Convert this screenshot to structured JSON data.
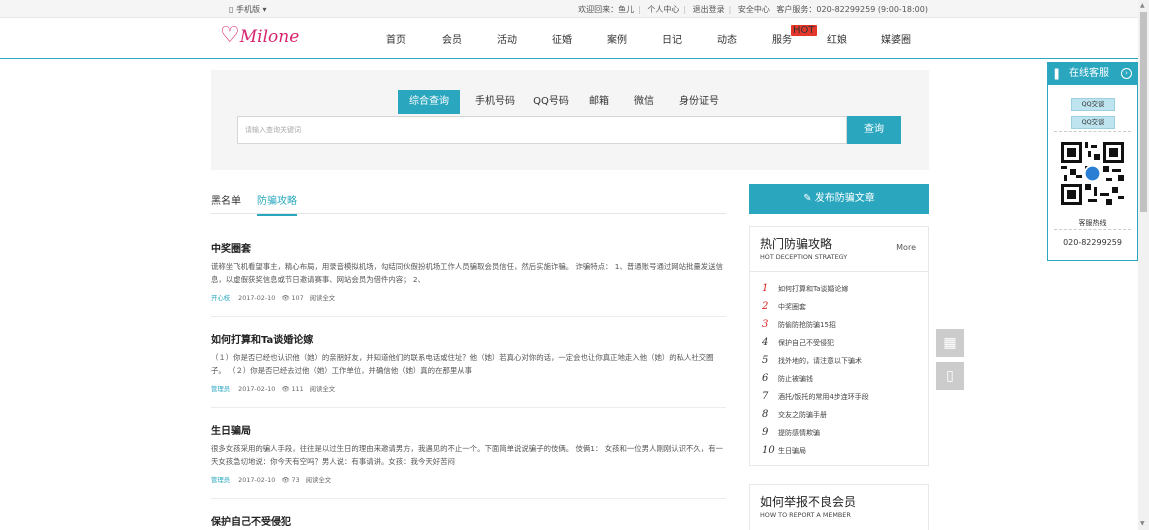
{
  "topbar": {
    "mobile": "▯ 手机版 ▾",
    "welcome": "欢迎回来：鱼儿",
    "user_center": "个人中心",
    "logout": "退出登录",
    "security": "安全中心",
    "service": "客户服务：020-82299259 (9:00-18:00)"
  },
  "header": {
    "logo_text": "Milone",
    "nav": [
      "首页",
      "会员",
      "活动",
      "征婚",
      "案例",
      "日记",
      "动态",
      "服务",
      "红娘",
      "媒婆圈"
    ],
    "hot_badge": "HOT"
  },
  "search": {
    "tabs": [
      "综合查询",
      "手机号码",
      "QQ号码",
      "邮箱",
      "微信",
      "身份证号"
    ],
    "placeholder": "请输入查询关键词",
    "button": "查询"
  },
  "list_tabs": [
    "黑名单",
    "防骗攻略"
  ],
  "articles": [
    {
      "title": "中奖圈套",
      "desc": "谎称坐飞机看望事主，精心布局，用录音模拟机场，勾结同伙假扮机场工作人员骗取会员信任，然后实施诈骗。 诈骗特点： 1、普通账号通过网站批量发送信息，以虚假获奖信息或节日邀请赛事、网站会员为借件内容； 2、",
      "author": "开心枝",
      "date": "2017-02-10",
      "views": "107",
      "read": "阅读全文"
    },
    {
      "title": "如何打算和Ta谈婚论嫁",
      "desc": "（１）你是否已经也认识他（她）的亲朋好友，并知道他们的联系电话或住址？他（她）若真心对你的话，一定会也让你真正地走入他（她）的私人社交圈子。 （２）你是否已经去过他（她）工作单位，并确信他（她）真的在那里从事",
      "author": "管理员",
      "date": "2017-02-10",
      "views": "111",
      "read": "阅读全文"
    },
    {
      "title": "生日骗局",
      "desc": "很多女孩采用的骗人手段，往往是以过生日的理由来邀请男方，我遇见的不止一个。下面简单说说骗子的伎俩。 伎俩1： 女孩和一位男人刚刚认识不久，有一天女孩急切地说：你今天有空吗？男人说：有事请讲。女孩：我今天好苦闷",
      "author": "管理员",
      "date": "2017-02-10",
      "views": "73",
      "read": "阅读全文"
    },
    {
      "title": "保护自己不受侵犯"
    }
  ],
  "publish_button": "发布防骗文章",
  "hot": {
    "title": "热门防骗攻略",
    "subtitle": "HOT DECEPTION STRATEGY",
    "more": "More",
    "items": [
      {
        "num": "1",
        "text": "如何打算和Ta谈婚论嫁"
      },
      {
        "num": "2",
        "text": "中奖圈套"
      },
      {
        "num": "3",
        "text": "防偷防抢防骗15招"
      },
      {
        "num": "4",
        "text": "保护自己不受侵犯"
      },
      {
        "num": "5",
        "text": "找外地的，请注意以下骗术"
      },
      {
        "num": "6",
        "text": "防止被骗钱"
      },
      {
        "num": "7",
        "text": "酒托/饭托的常用4步连环手段"
      },
      {
        "num": "8",
        "text": "交友之防骗手册"
      },
      {
        "num": "9",
        "text": "提防感情欺骗"
      },
      {
        "num": "10",
        "text": "生日骗局"
      }
    ]
  },
  "report": {
    "title": "如何举报不良会员",
    "subtitle": "HOW TO REPORT A MEMBER"
  },
  "service": {
    "title": "在线客服",
    "qq1": "QQ交谈",
    "qq2": "QQ交谈",
    "hotline_label": "客服热线",
    "hotline": "020-82299259"
  },
  "colors": {
    "accent": "#2aa7bf",
    "logo": "#d6246e",
    "hot_red": "#e3372b"
  }
}
